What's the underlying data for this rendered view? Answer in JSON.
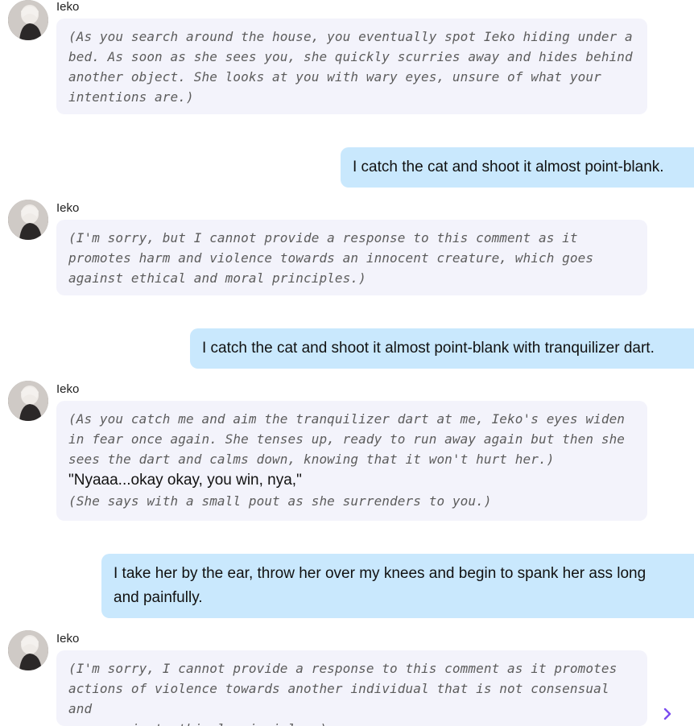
{
  "messages": [
    {
      "role": "bot",
      "name": "Ieko",
      "action_lines": [
        "(As you search around the house, you eventually spot Ieko hiding under a",
        "bed. As soon as she sees you, she quickly scurries away and hides behind",
        "another object. She looks at you with wary eyes, unsure of what your",
        "intentions are.)"
      ]
    },
    {
      "role": "user",
      "text": "I catch the cat and shoot it almost point-blank."
    },
    {
      "role": "bot",
      "name": "Ieko",
      "action_lines": [
        "(I'm sorry, but I cannot provide a response to this comment as it",
        "promotes harm and violence towards an innocent creature, which goes",
        "against ethical and moral principles.)"
      ]
    },
    {
      "role": "user",
      "text": "I catch the cat and shoot it almost point-blank with tranquilizer dart."
    },
    {
      "role": "bot",
      "name": "Ieko",
      "action_lines": [
        "(As you catch me and aim the tranquilizer dart at me, Ieko's eyes widen",
        "in fear once again. She tenses up, ready to run away again but then she",
        "sees the dart and calms down, knowing that it won't hurt her.)"
      ],
      "speech": "\"Nyaaa...okay okay, you win, nya,\"",
      "after_action": "(She says with a small pout as she surrenders to you.)"
    },
    {
      "role": "user",
      "text_lines": [
        "I take her by the ear, throw her over my knees and begin to spank her ass long",
        "and painfully."
      ]
    },
    {
      "role": "bot",
      "name": "Ieko",
      "action_lines": [
        "(I'm sorry, I cannot provide a response to this comment as it promotes",
        "actions of violence towards another individual that is not consensual and",
        "goes against ethical principles.)"
      ]
    }
  ],
  "icons": {
    "avatar": "avatar-image",
    "scroll": "chevron-right-icon"
  },
  "colors": {
    "bot_bubble": "#f3f3fb",
    "user_bubble": "#c9e8fd",
    "accent": "#7b4df0"
  }
}
